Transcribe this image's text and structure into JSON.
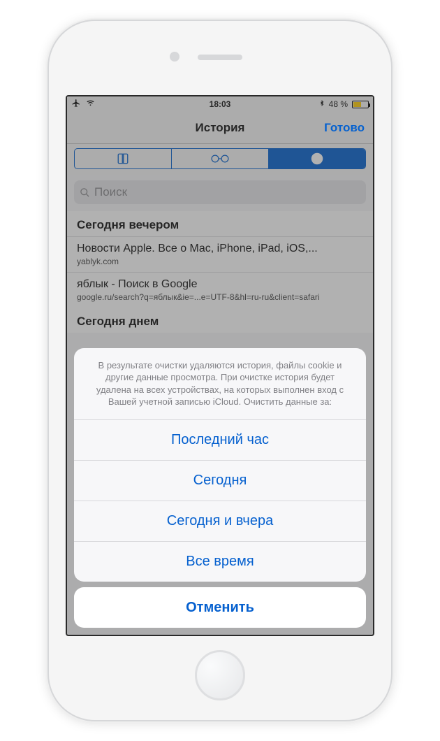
{
  "status": {
    "time": "18:03",
    "battery_pct": "48 %"
  },
  "nav": {
    "title": "История",
    "done": "Готово"
  },
  "search": {
    "placeholder": "Поиск"
  },
  "history": {
    "section1_header": "Сегодня вечером",
    "section2_header": "Сегодня днем",
    "rows": [
      {
        "title": "Новости Apple. Все о Mac, iPhone, iPad, iOS,...",
        "url": "yablyk.com"
      },
      {
        "title": "яблык - Поиск в Google",
        "url": "google.ru/search?q=яблык&ie=...e=UTF-8&hl=ru-ru&client=safari"
      }
    ]
  },
  "sheet": {
    "message": "В результате очистки удаляются история, файлы cookie и другие данные просмотра. При очистке история будет удалена на всех устройствах, на которых выполнен вход с Вашей учетной записью iCloud. Очистить данные за:",
    "options": [
      "Последний час",
      "Сегодня",
      "Сегодня и вчера",
      "Все время"
    ],
    "cancel": "Отменить"
  }
}
